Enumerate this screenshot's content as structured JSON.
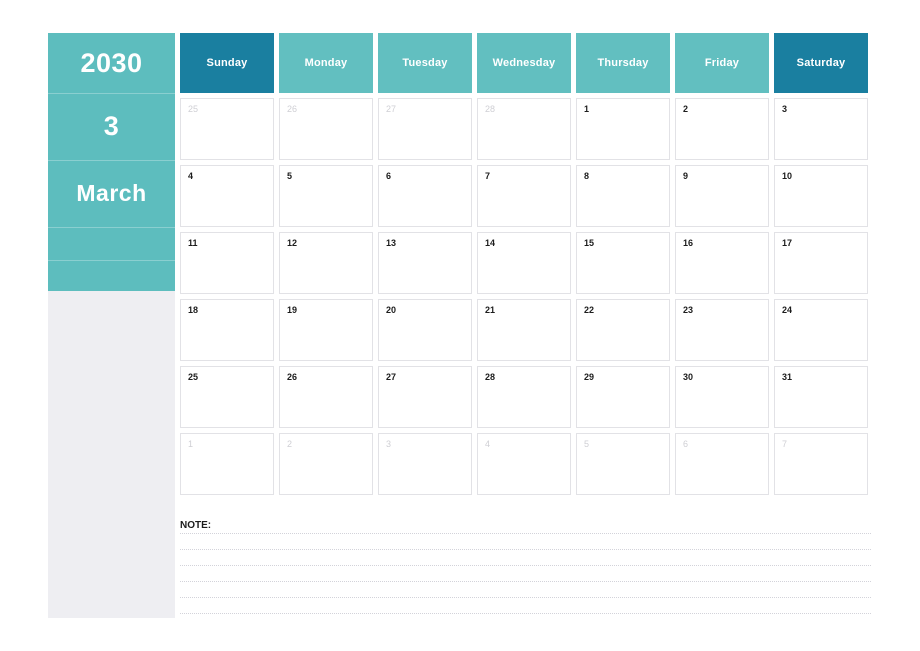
{
  "sidebar": {
    "year": "2030",
    "month_number": "3",
    "month_name": "March"
  },
  "calendar": {
    "weekday_headers": [
      {
        "label": "Sunday",
        "kind": "weekend"
      },
      {
        "label": "Monday",
        "kind": "weekday"
      },
      {
        "label": "Tuesday",
        "kind": "weekday"
      },
      {
        "label": "Wednesday",
        "kind": "weekday"
      },
      {
        "label": "Thursday",
        "kind": "weekday"
      },
      {
        "label": "Friday",
        "kind": "weekday"
      },
      {
        "label": "Saturday",
        "kind": "weekend"
      }
    ],
    "weeks": [
      [
        {
          "day": "25",
          "in_month": false
        },
        {
          "day": "26",
          "in_month": false
        },
        {
          "day": "27",
          "in_month": false
        },
        {
          "day": "28",
          "in_month": false
        },
        {
          "day": "1",
          "in_month": true
        },
        {
          "day": "2",
          "in_month": true
        },
        {
          "day": "3",
          "in_month": true
        }
      ],
      [
        {
          "day": "4",
          "in_month": true
        },
        {
          "day": "5",
          "in_month": true
        },
        {
          "day": "6",
          "in_month": true
        },
        {
          "day": "7",
          "in_month": true
        },
        {
          "day": "8",
          "in_month": true
        },
        {
          "day": "9",
          "in_month": true
        },
        {
          "day": "10",
          "in_month": true
        }
      ],
      [
        {
          "day": "11",
          "in_month": true
        },
        {
          "day": "12",
          "in_month": true
        },
        {
          "day": "13",
          "in_month": true
        },
        {
          "day": "14",
          "in_month": true
        },
        {
          "day": "15",
          "in_month": true
        },
        {
          "day": "16",
          "in_month": true
        },
        {
          "day": "17",
          "in_month": true
        }
      ],
      [
        {
          "day": "18",
          "in_month": true
        },
        {
          "day": "19",
          "in_month": true
        },
        {
          "day": "20",
          "in_month": true
        },
        {
          "day": "21",
          "in_month": true
        },
        {
          "day": "22",
          "in_month": true
        },
        {
          "day": "23",
          "in_month": true
        },
        {
          "day": "24",
          "in_month": true
        }
      ],
      [
        {
          "day": "25",
          "in_month": true
        },
        {
          "day": "26",
          "in_month": true
        },
        {
          "day": "27",
          "in_month": true
        },
        {
          "day": "28",
          "in_month": true
        },
        {
          "day": "29",
          "in_month": true
        },
        {
          "day": "30",
          "in_month": true
        },
        {
          "day": "31",
          "in_month": true
        }
      ],
      [
        {
          "day": "1",
          "in_month": false
        },
        {
          "day": "2",
          "in_month": false
        },
        {
          "day": "3",
          "in_month": false
        },
        {
          "day": "4",
          "in_month": false
        },
        {
          "day": "5",
          "in_month": false
        },
        {
          "day": "6",
          "in_month": false
        },
        {
          "day": "7",
          "in_month": false
        }
      ]
    ]
  },
  "note": {
    "label": "NOTE:",
    "line_count": 6
  },
  "colors": {
    "header_weekend": "#1a7fa0",
    "header_weekday": "#62bfc0",
    "sidebar_teal": "#5dbdbe",
    "sidebar_panel": "#eeeef2",
    "day_text": "#1c1c1c",
    "day_text_muted": "#cfcfd4",
    "cell_border": "#e2e2e6"
  }
}
